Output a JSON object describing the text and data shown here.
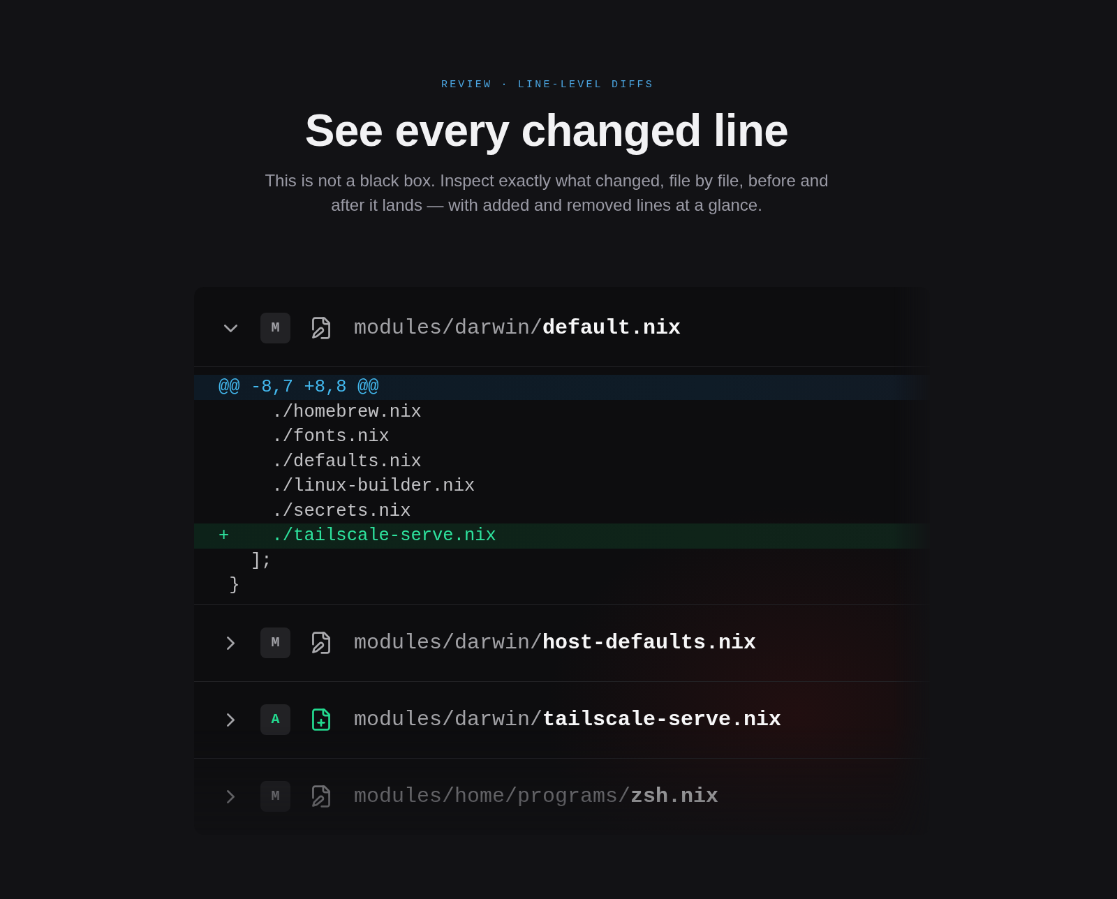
{
  "header": {
    "eyebrow": "REVIEW · LINE-LEVEL DIFFS",
    "title": "See every changed line",
    "subtitle": "This is not a black box. Inspect exactly what changed, file by file, before and after it lands — with added and removed lines at a glance."
  },
  "files": [
    {
      "kind": "modified",
      "status": "M",
      "dir": "modules/darwin/",
      "name": "default.nix",
      "expanded": true,
      "diff": [
        {
          "kind": "hunk",
          "text": "@@ -8,7 +8,8 @@"
        },
        {
          "kind": "context",
          "text": "    ./homebrew.nix"
        },
        {
          "kind": "context",
          "text": "    ./fonts.nix"
        },
        {
          "kind": "context",
          "text": "    ./defaults.nix"
        },
        {
          "kind": "context",
          "text": "    ./linux-builder.nix"
        },
        {
          "kind": "context",
          "text": "    ./secrets.nix"
        },
        {
          "kind": "added",
          "sign": "+",
          "text": "    ./tailscale-serve.nix"
        },
        {
          "kind": "context",
          "text": "  ];"
        },
        {
          "kind": "context",
          "text": "}"
        }
      ]
    },
    {
      "kind": "modified",
      "status": "M",
      "dir": "modules/darwin/",
      "name": "host-defaults.nix",
      "expanded": false
    },
    {
      "kind": "added",
      "status": "A",
      "dir": "modules/darwin/",
      "name": "tailscale-serve.nix",
      "expanded": false
    },
    {
      "kind": "modified",
      "status": "M",
      "dir": "modules/home/programs/",
      "name": "zsh.nix",
      "expanded": false
    }
  ]
}
